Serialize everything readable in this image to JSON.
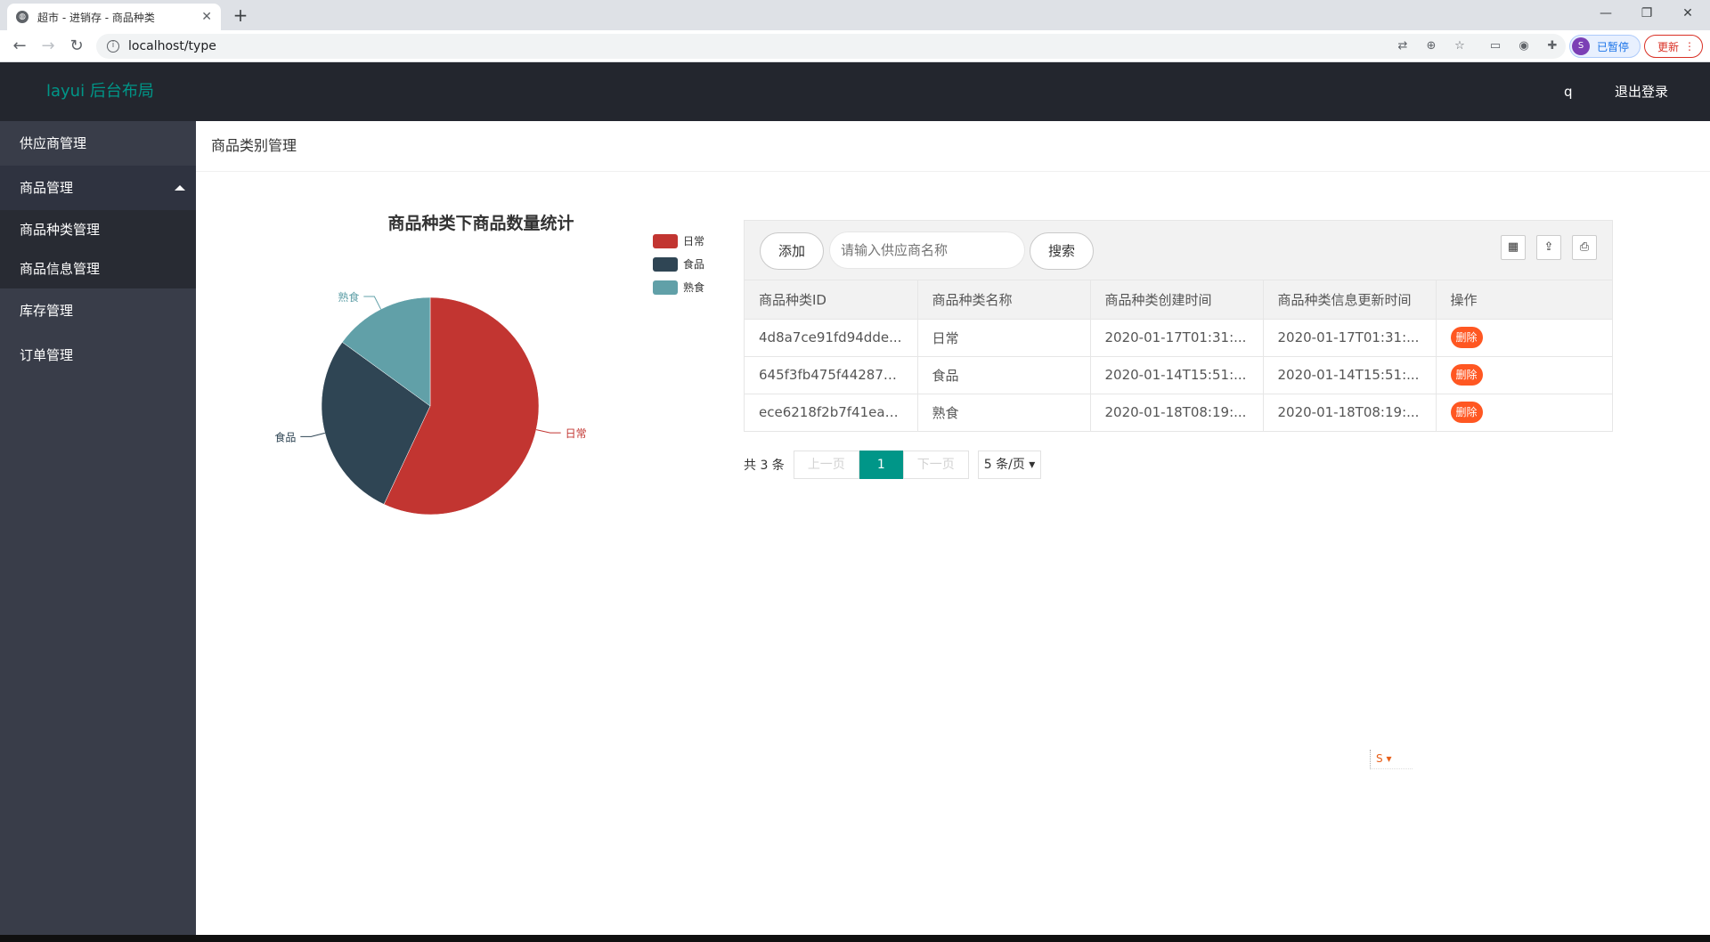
{
  "browser": {
    "tab_title": "超市 - 进销存 - 商品种类",
    "tab_close": "✕",
    "new_tab": "+",
    "url": "localhost/type",
    "profile_label": "已暂停",
    "profile_initial": "S",
    "update_label": "更新"
  },
  "header": {
    "logo": "layui 后台布局",
    "user": "q",
    "logout": "退出登录"
  },
  "sidebar": {
    "items": [
      {
        "label": "供应商管理"
      },
      {
        "label": "商品管理"
      },
      {
        "label": "库存管理"
      },
      {
        "label": "订单管理"
      }
    ],
    "sub_items": [
      {
        "label": "商品种类管理"
      },
      {
        "label": "商品信息管理"
      }
    ]
  },
  "main": {
    "page_title": "商品类别管理"
  },
  "chart_data": {
    "type": "pie",
    "title": "商品种类下商品数量统计",
    "legend_position": "top-right",
    "slices": [
      {
        "name": "日常",
        "value": 57,
        "color": "#c23531"
      },
      {
        "name": "食品",
        "value": 28,
        "color": "#2f4554"
      },
      {
        "name": "熟食",
        "value": 15,
        "color": "#61a0a8"
      }
    ]
  },
  "table": {
    "add_label": "添加",
    "search_placeholder": "请输入供应商名称",
    "search_label": "搜索",
    "columns": [
      "商品种类ID",
      "商品种类名称",
      "商品种类创建时间",
      "商品种类信息更新时间",
      "操作"
    ],
    "rows": [
      {
        "id": "4d8a7ce91fd94dde...",
        "name": "日常",
        "created": "2020-01-17T01:31:...",
        "updated": "2020-01-17T01:31:...",
        "action": "删除"
      },
      {
        "id": "645f3fb475f442878...",
        "name": "食品",
        "created": "2020-01-14T15:51:...",
        "updated": "2020-01-14T15:51:...",
        "action": "删除"
      },
      {
        "id": "ece6218f2b7f41eab...",
        "name": "熟食",
        "created": "2020-01-18T08:19:...",
        "updated": "2020-01-18T08:19:...",
        "action": "删除"
      }
    ]
  },
  "pager": {
    "total": "共 3 条",
    "prev": "上一页",
    "current": "1",
    "next": "下一页",
    "page_size": "5 条/页"
  }
}
